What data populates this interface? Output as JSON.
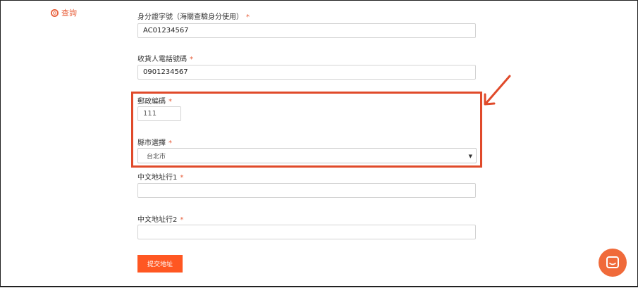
{
  "sidebar": {
    "query_label": "查詢",
    "query_icon": "lifebuoy-icon"
  },
  "form": {
    "id_number": {
      "label": "身分證字號（海關查驗身分使用）",
      "required": "*",
      "value": "AC01234567"
    },
    "phone": {
      "label": "收貨人電話號碼",
      "required": "*",
      "value": "0901234567"
    },
    "postal_code": {
      "label": "郵政編碼",
      "required": "*",
      "value": "111"
    },
    "city": {
      "label": "縣市選擇",
      "required": "*",
      "selected": "台北市"
    },
    "address1": {
      "label": "中文地址行1",
      "required": "*",
      "value": ""
    },
    "address2": {
      "label": "中文地址行2",
      "required": "*",
      "value": ""
    },
    "submit_label": "提交地址"
  },
  "colors": {
    "accent": "#ff5722",
    "highlight": "#e04a2a",
    "chat": "#f06a3a"
  },
  "chat": {
    "icon": "chat-icon"
  }
}
